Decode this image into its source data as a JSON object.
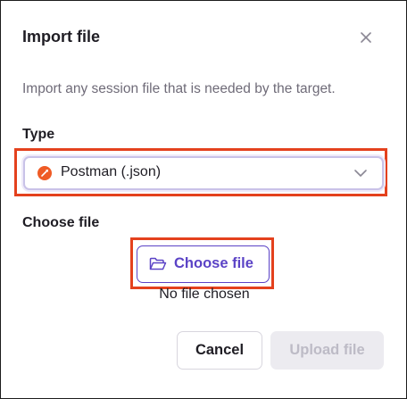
{
  "dialog": {
    "title": "Import file",
    "description": "Import any session file that is needed by the target.",
    "close_icon": "close-icon"
  },
  "type_field": {
    "label": "Type",
    "selected_value": "Postman (.json)",
    "selected_icon": "postman-icon",
    "dropdown_icon": "chevron-down-icon"
  },
  "file_field": {
    "label": "Choose file",
    "button_label": "Choose file",
    "button_icon": "folder-open-icon",
    "status_text": "No file chosen"
  },
  "footer": {
    "cancel_label": "Cancel",
    "upload_label": "Upload file",
    "upload_enabled": false
  },
  "colors": {
    "accent": "#5b43c6",
    "highlight": "#e4411d",
    "postman": "#ef5b25",
    "disabled_bg": "#ecebf0"
  }
}
